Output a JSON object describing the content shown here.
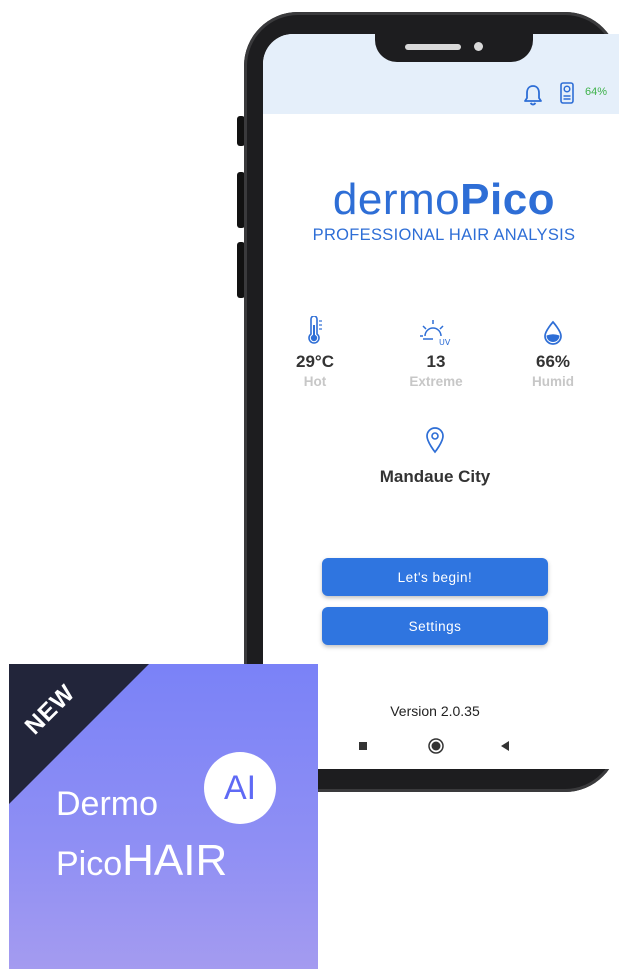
{
  "status_bar": {
    "battery": "64%",
    "bell_icon": "bell-icon",
    "device_icon": "device-icon"
  },
  "logo": {
    "part1": "dermo",
    "part2": "Pico",
    "subtitle": "PROFESSIONAL HAIR ANALYSIS",
    "color": "#2e6ed6"
  },
  "weather": {
    "temperature": {
      "value": "29°C",
      "label": "Hot",
      "icon": "thermometer-icon"
    },
    "uv": {
      "value": "13",
      "label": "Extreme",
      "icon": "uv-sun-icon"
    },
    "humidity": {
      "value": "66%",
      "label": "Humid",
      "icon": "water-drop-icon"
    }
  },
  "location": {
    "city": "Mandaue City",
    "icon": "location-pin-icon"
  },
  "buttons": {
    "begin": "Let's begin!",
    "settings": "Settings",
    "color": "#2f75e0"
  },
  "version": "Version 2.0.35",
  "badge": {
    "ribbon": "NEW",
    "line1": "Dermo",
    "ai": "AI",
    "pico": "Pico",
    "hair": "HAIR"
  }
}
